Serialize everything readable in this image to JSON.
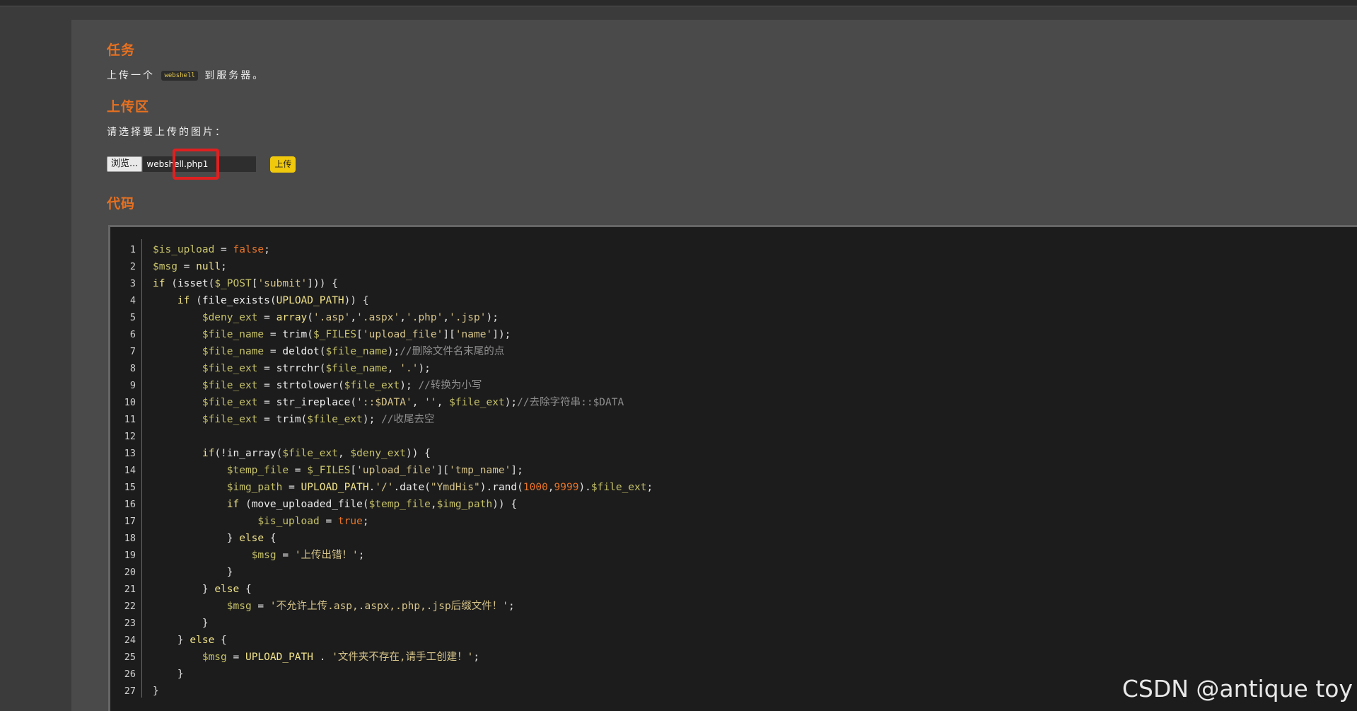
{
  "task": {
    "heading": "任务",
    "text_before": "上传一个",
    "code_tag": "webshell",
    "text_after": "到服务器。"
  },
  "upload": {
    "heading": "上传区",
    "label": "请选择要上传的图片：",
    "browse_label": "浏览...",
    "file_name": "webshell.php1",
    "submit_label": "上传"
  },
  "code": {
    "heading": "代码",
    "line_numbers": [
      "1",
      "2",
      "3",
      "4",
      "5",
      "6",
      "7",
      "8",
      "9",
      "10",
      "11",
      "12",
      "13",
      "14",
      "15",
      "16",
      "17",
      "18",
      "19",
      "20",
      "21",
      "22",
      "23",
      "24",
      "25",
      "26",
      "27"
    ],
    "lines": [
      [
        [
          "v",
          "$is_upload"
        ],
        [
          "p",
          " = "
        ],
        [
          "b",
          "false"
        ],
        [
          "p",
          ";"
        ]
      ],
      [
        [
          "v",
          "$msg"
        ],
        [
          "p",
          " = "
        ],
        [
          "k",
          "null"
        ],
        [
          "p",
          ";"
        ]
      ],
      [
        [
          "k",
          "if"
        ],
        [
          "p",
          " ("
        ],
        [
          "f",
          "isset"
        ],
        [
          "p",
          "("
        ],
        [
          "v",
          "$_POST"
        ],
        [
          "p",
          "["
        ],
        [
          "s",
          "'submit'"
        ],
        [
          "p",
          "])) {"
        ]
      ],
      [
        [
          "p",
          "    "
        ],
        [
          "k",
          "if"
        ],
        [
          "p",
          " ("
        ],
        [
          "f",
          "file_exists"
        ],
        [
          "p",
          "("
        ],
        [
          "k",
          "UPLOAD_PATH"
        ],
        [
          "p",
          ")) {"
        ]
      ],
      [
        [
          "p",
          "        "
        ],
        [
          "v",
          "$deny_ext"
        ],
        [
          "p",
          " = "
        ],
        [
          "k",
          "array"
        ],
        [
          "p",
          "("
        ],
        [
          "s",
          "'.asp'"
        ],
        [
          "p",
          ","
        ],
        [
          "s",
          "'.aspx'"
        ],
        [
          "p",
          ","
        ],
        [
          "s",
          "'.php'"
        ],
        [
          "p",
          ","
        ],
        [
          "s",
          "'.jsp'"
        ],
        [
          "p",
          ");"
        ]
      ],
      [
        [
          "p",
          "        "
        ],
        [
          "v",
          "$file_name"
        ],
        [
          "p",
          " = "
        ],
        [
          "f",
          "trim"
        ],
        [
          "p",
          "("
        ],
        [
          "v",
          "$_FILES"
        ],
        [
          "p",
          "["
        ],
        [
          "s",
          "'upload_file'"
        ],
        [
          "p",
          "]["
        ],
        [
          "s",
          "'name'"
        ],
        [
          "p",
          "]);"
        ]
      ],
      [
        [
          "p",
          "        "
        ],
        [
          "v",
          "$file_name"
        ],
        [
          "p",
          " = "
        ],
        [
          "f",
          "deldot"
        ],
        [
          "p",
          "("
        ],
        [
          "v",
          "$file_name"
        ],
        [
          "p",
          ");"
        ],
        [
          "c",
          "//删除文件名末尾的点"
        ]
      ],
      [
        [
          "p",
          "        "
        ],
        [
          "v",
          "$file_ext"
        ],
        [
          "p",
          " = "
        ],
        [
          "f",
          "strrchr"
        ],
        [
          "p",
          "("
        ],
        [
          "v",
          "$file_name"
        ],
        [
          "p",
          ", "
        ],
        [
          "s",
          "'.'"
        ],
        [
          "p",
          ");"
        ]
      ],
      [
        [
          "p",
          "        "
        ],
        [
          "v",
          "$file_ext"
        ],
        [
          "p",
          " = "
        ],
        [
          "f",
          "strtolower"
        ],
        [
          "p",
          "("
        ],
        [
          "v",
          "$file_ext"
        ],
        [
          "p",
          "); "
        ],
        [
          "c",
          "//转换为小写"
        ]
      ],
      [
        [
          "p",
          "        "
        ],
        [
          "v",
          "$file_ext"
        ],
        [
          "p",
          " = "
        ],
        [
          "f",
          "str_ireplace"
        ],
        [
          "p",
          "("
        ],
        [
          "s",
          "'::$DATA'"
        ],
        [
          "p",
          ", "
        ],
        [
          "s",
          "''"
        ],
        [
          "p",
          ", "
        ],
        [
          "v",
          "$file_ext"
        ],
        [
          "p",
          ");"
        ],
        [
          "c",
          "//去除字符串::$DATA"
        ]
      ],
      [
        [
          "p",
          "        "
        ],
        [
          "v",
          "$file_ext"
        ],
        [
          "p",
          " = "
        ],
        [
          "f",
          "trim"
        ],
        [
          "p",
          "("
        ],
        [
          "v",
          "$file_ext"
        ],
        [
          "p",
          "); "
        ],
        [
          "c",
          "//收尾去空"
        ]
      ],
      [
        [
          "p",
          " "
        ]
      ],
      [
        [
          "p",
          "        "
        ],
        [
          "k",
          "if"
        ],
        [
          "p",
          "(!"
        ],
        [
          "f",
          "in_array"
        ],
        [
          "p",
          "("
        ],
        [
          "v",
          "$file_ext"
        ],
        [
          "p",
          ", "
        ],
        [
          "v",
          "$deny_ext"
        ],
        [
          "p",
          ")) {"
        ]
      ],
      [
        [
          "p",
          "            "
        ],
        [
          "v",
          "$temp_file"
        ],
        [
          "p",
          " = "
        ],
        [
          "v",
          "$_FILES"
        ],
        [
          "p",
          "["
        ],
        [
          "s",
          "'upload_file'"
        ],
        [
          "p",
          "]["
        ],
        [
          "s",
          "'tmp_name'"
        ],
        [
          "p",
          "];"
        ]
      ],
      [
        [
          "p",
          "            "
        ],
        [
          "v",
          "$img_path"
        ],
        [
          "p",
          " = "
        ],
        [
          "k",
          "UPLOAD_PATH"
        ],
        [
          "p",
          "."
        ],
        [
          "s",
          "'/'"
        ],
        [
          "p",
          "."
        ],
        [
          "f",
          "date"
        ],
        [
          "p",
          "("
        ],
        [
          "s",
          "\"YmdHis\""
        ],
        [
          "p",
          ")."
        ],
        [
          "f",
          "rand"
        ],
        [
          "p",
          "("
        ],
        [
          "b",
          "1000"
        ],
        [
          "p",
          ","
        ],
        [
          "b",
          "9999"
        ],
        [
          "p",
          ")."
        ],
        [
          "v",
          "$file_ext"
        ],
        [
          "p",
          ";"
        ]
      ],
      [
        [
          "p",
          "            "
        ],
        [
          "k",
          "if"
        ],
        [
          "p",
          " ("
        ],
        [
          "f",
          "move_uploaded_file"
        ],
        [
          "p",
          "("
        ],
        [
          "v",
          "$temp_file"
        ],
        [
          "p",
          ","
        ],
        [
          "v",
          "$img_path"
        ],
        [
          "p",
          ")) {"
        ]
      ],
      [
        [
          "p",
          "                 "
        ],
        [
          "v",
          "$is_upload"
        ],
        [
          "p",
          " = "
        ],
        [
          "b",
          "true"
        ],
        [
          "p",
          ";"
        ]
      ],
      [
        [
          "p",
          "            } "
        ],
        [
          "k",
          "else"
        ],
        [
          "p",
          " {"
        ]
      ],
      [
        [
          "p",
          "                "
        ],
        [
          "v",
          "$msg"
        ],
        [
          "p",
          " = "
        ],
        [
          "s",
          "'上传出错！'"
        ],
        [
          "p",
          ";"
        ]
      ],
      [
        [
          "p",
          "            }"
        ]
      ],
      [
        [
          "p",
          "        } "
        ],
        [
          "k",
          "else"
        ],
        [
          "p",
          " {"
        ]
      ],
      [
        [
          "p",
          "            "
        ],
        [
          "v",
          "$msg"
        ],
        [
          "p",
          " = "
        ],
        [
          "s",
          "'不允许上传.asp,.aspx,.php,.jsp后缀文件！'"
        ],
        [
          "p",
          ";"
        ]
      ],
      [
        [
          "p",
          "        }"
        ]
      ],
      [
        [
          "p",
          "    } "
        ],
        [
          "k",
          "else"
        ],
        [
          "p",
          " {"
        ]
      ],
      [
        [
          "p",
          "        "
        ],
        [
          "v",
          "$msg"
        ],
        [
          "p",
          " = "
        ],
        [
          "k",
          "UPLOAD_PATH"
        ],
        [
          "p",
          " . "
        ],
        [
          "s",
          "'文件夹不存在,请手工创建！'"
        ],
        [
          "p",
          ";"
        ]
      ],
      [
        [
          "p",
          "    }"
        ]
      ],
      [
        [
          "p",
          "}"
        ]
      ]
    ]
  },
  "watermark": "CSDN @antique toy"
}
